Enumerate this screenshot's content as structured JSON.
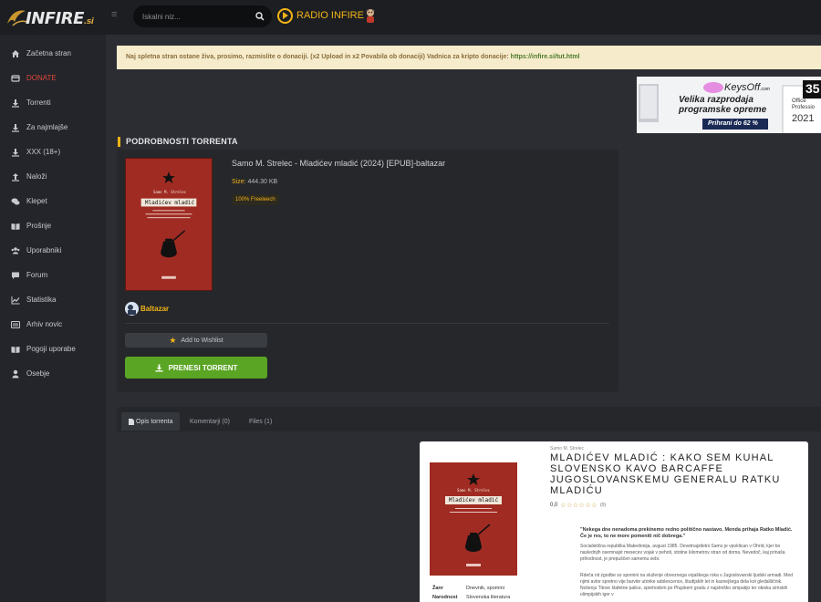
{
  "header": {
    "logo_text": "INFIRE",
    "logo_suffix": ".si",
    "search_placeholder": "Iskalni niz...",
    "radio_label": "RADIO INFIRE"
  },
  "sidebar": {
    "items": [
      {
        "label": "Začetna stran",
        "icon": "home-icon"
      },
      {
        "label": "DONATE",
        "icon": "donate-icon"
      },
      {
        "label": "Torrenti",
        "icon": "download-icon"
      },
      {
        "label": "Za najmlajše",
        "icon": "download-icon"
      },
      {
        "label": "XXX (18+)",
        "icon": "download-icon"
      },
      {
        "label": "Naloži",
        "icon": "upload-icon"
      },
      {
        "label": "Klepet",
        "icon": "chat-icon"
      },
      {
        "label": "Prošnje",
        "icon": "book-icon"
      },
      {
        "label": "Uporabniki",
        "icon": "users-icon"
      },
      {
        "label": "Forum",
        "icon": "forum-icon"
      },
      {
        "label": "Statistika",
        "icon": "chart-icon"
      },
      {
        "label": "Arhiv novic",
        "icon": "archive-icon"
      },
      {
        "label": "Pogoji uporabe",
        "icon": "book-icon"
      },
      {
        "label": "Osebje",
        "icon": "user-icon"
      }
    ]
  },
  "notice": {
    "text": "Naj spletna stran ostane živa, prosimo, razmislite o donaciji.   (x2 Upload in x2 Povabila ob donaciji)   Vadnica za kripto donacije: ",
    "link": "https://infire.si/tut.html"
  },
  "ad": {
    "brand": "KeysOff",
    "brand_suffix": ".com",
    "line1": "Velika razprodaja",
    "line2": "programske opreme",
    "cta": "Prihrani do 62 %",
    "badge": "35",
    "side_text1": "Office",
    "side_text2": "Professio",
    "side_year": "2021"
  },
  "details": {
    "section_title": "PODROBNOSTI TORRENTA",
    "torrent_title": "Samo M. Strelec - Mladićev mladić (2024) [EPUB]-baltazar",
    "size_label": "Size:",
    "size_value": "444.30 KB",
    "freeleech": "100% Freeleech",
    "uploader": "Baltazar",
    "wishlist_label": "Add to Wishlist",
    "download_label": "PRENESI TORRENT"
  },
  "cover": {
    "author": "Samo M. Strelec",
    "title": "Mladićev mladić"
  },
  "tabs": [
    {
      "label": "Opis torrenta",
      "active": true
    },
    {
      "label": "Komentarji (0)",
      "active": false
    },
    {
      "label": "Files (1)",
      "active": false
    }
  ],
  "book": {
    "author": "Samo M. Strelec",
    "title": "MLADIĆEV MLADIĆ : KAKO SEM KUHAL SLOVENSKO KAVO BARCAFFE JUGOSLOVANSKEMU GENERALU RATKU MLADIĆU",
    "rating": "0,0",
    "rating_stars": "☆☆☆☆☆☆",
    "rating_count": "(0)",
    "quote": "\"Nekega dne nenadoma prekinemo redno politično nastavo. Menda prihaja Ratko Mladić. Če je res, to ne more pomeniti nič dobrega.\"",
    "para1": "Socialistična republika Makedonija, avgust 1985. Devetnajstletni Samo je vpoklican v Ohrid, kjer bo naslednjih osemnajst mesecev vojak v pehoti, stotine kilometrov stran od doma. Nevedoč, kaj prinaša prihodnost, je prepuščen samemu sebi.",
    "para2": "Rdeča nit zgodbe so spomini na služenje obveznega vojaškega roka v Jugoslovanski ljudski armadi. Med njimi avtor spretno vije barvite utrinke adolescence, študijskih let in kasnejšega dela kot gledališčnik. Nošenju Titove štafetne palice, sprehodom po Ptujskem gradu z najstniško simpatijo ter obisku zimskih olimpijskih iger v",
    "meta": [
      {
        "k": "Žanr",
        "v": "Dnevnik, spomini"
      },
      {
        "k": "Narodnost",
        "v": "Slovenska literatura"
      }
    ]
  }
}
